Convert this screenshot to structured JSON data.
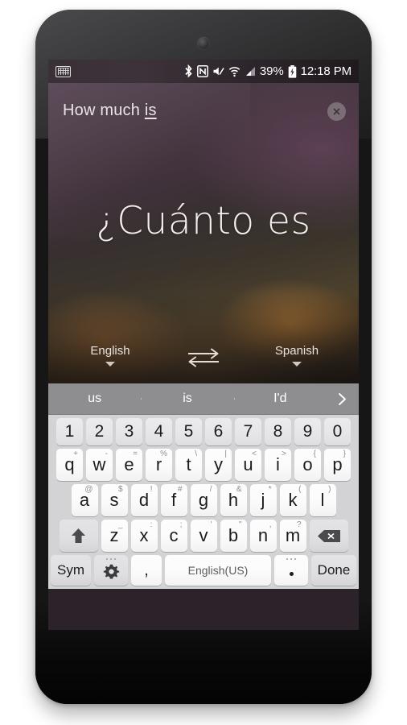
{
  "statusbar": {
    "keyboard_icon": "keyboard-icon",
    "icons": [
      "bluetooth-icon",
      "nfc-icon",
      "mute-icon",
      "wifi-icon",
      "cellular-signal-icon"
    ],
    "battery_percent": "39%",
    "battery_icon": "battery-charging-icon",
    "clock": "12:18 PM"
  },
  "translate": {
    "source_prefix": "How much ",
    "source_underlined": "is",
    "source_full": "How much is",
    "target_text": "¿Cuánto es",
    "close_icon": "close-icon",
    "source_language": "English",
    "target_language": "Spanish",
    "swap_icon": "swap-arrows-icon"
  },
  "keyboard": {
    "suggestions": [
      "us",
      "is",
      "I'd"
    ],
    "more_suggestions_icon": "chevron-right-icon",
    "number_row": [
      "1",
      "2",
      "3",
      "4",
      "5",
      "6",
      "7",
      "8",
      "9",
      "0"
    ],
    "row1": [
      {
        "main": "q",
        "sub": "+"
      },
      {
        "main": "w",
        "sub": "-"
      },
      {
        "main": "e",
        "sub": "="
      },
      {
        "main": "r",
        "sub": "%"
      },
      {
        "main": "t",
        "sub": "\\"
      },
      {
        "main": "y",
        "sub": "|"
      },
      {
        "main": "u",
        "sub": "<"
      },
      {
        "main": "i",
        "sub": ">"
      },
      {
        "main": "o",
        "sub": "{"
      },
      {
        "main": "p",
        "sub": "}"
      }
    ],
    "row2": [
      {
        "main": "a",
        "sub": "@"
      },
      {
        "main": "s",
        "sub": "$"
      },
      {
        "main": "d",
        "sub": "!"
      },
      {
        "main": "f",
        "sub": "#"
      },
      {
        "main": "g",
        "sub": "/"
      },
      {
        "main": "h",
        "sub": "&"
      },
      {
        "main": "j",
        "sub": "*"
      },
      {
        "main": "k",
        "sub": "("
      },
      {
        "main": "l",
        "sub": ")"
      }
    ],
    "row3": [
      {
        "main": "z",
        "sub": "_"
      },
      {
        "main": "x",
        "sub": ":"
      },
      {
        "main": "c",
        "sub": ";"
      },
      {
        "main": "v",
        "sub": "'"
      },
      {
        "main": "b",
        "sub": "\""
      },
      {
        "main": "n",
        "sub": ","
      },
      {
        "main": "m",
        "sub": "?"
      }
    ],
    "shift_icon": "shift-arrow-icon",
    "backspace_icon": "backspace-icon",
    "sym_label": "Sym",
    "gear_icon": "settings-gear-icon",
    "comma_label": ",",
    "space_label": "English(US)",
    "period_label": ".",
    "done_label": "Done"
  },
  "colors": {
    "keyboard_bg": "#d3d3d5",
    "suggestion_bar": "#8e8e90",
    "key_white": "#fbfbfb",
    "key_gray": "#e4e4e6",
    "phone_body": "#161616"
  }
}
